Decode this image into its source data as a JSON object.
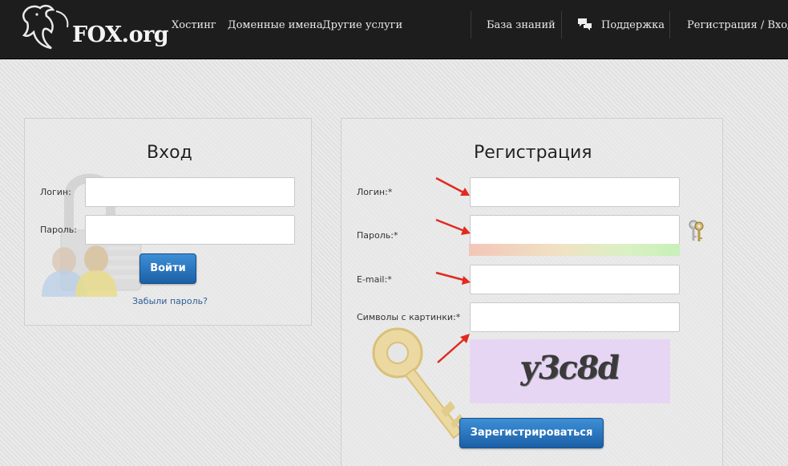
{
  "header": {
    "logo_text": "FOX.org",
    "nav": [
      "Хостинг",
      "Доменные имена",
      "Другие услуги"
    ],
    "right": {
      "knowledge_base": "База знаний",
      "support": "Поддержка",
      "auth": "Регистрация / Вход"
    }
  },
  "login": {
    "title": "Вход",
    "login_label": "Логин:",
    "login_value": "",
    "password_label": "Пароль:",
    "password_value": "",
    "submit": "Войти",
    "forgot": "Забыли пароль?"
  },
  "register": {
    "title": "Регистрация",
    "login_label": "Логин:*",
    "password_label": "Пароль:*",
    "email_label": "E-mail:*",
    "captcha_label": "Символы с картинки:*",
    "captcha_text": "y3c8d",
    "submit": "Зарегистрироваться"
  },
  "colors": {
    "header_bg": "#1d1d1d",
    "button": "#2a75c2",
    "arrow": "#e02a1f",
    "captcha_bg": "#e6d6f4"
  },
  "icons": [
    "horse-logo-icon",
    "chat-bubbles-icon",
    "padlock-users-icon",
    "key-icon",
    "keys-icon",
    "red-arrow-icon"
  ]
}
